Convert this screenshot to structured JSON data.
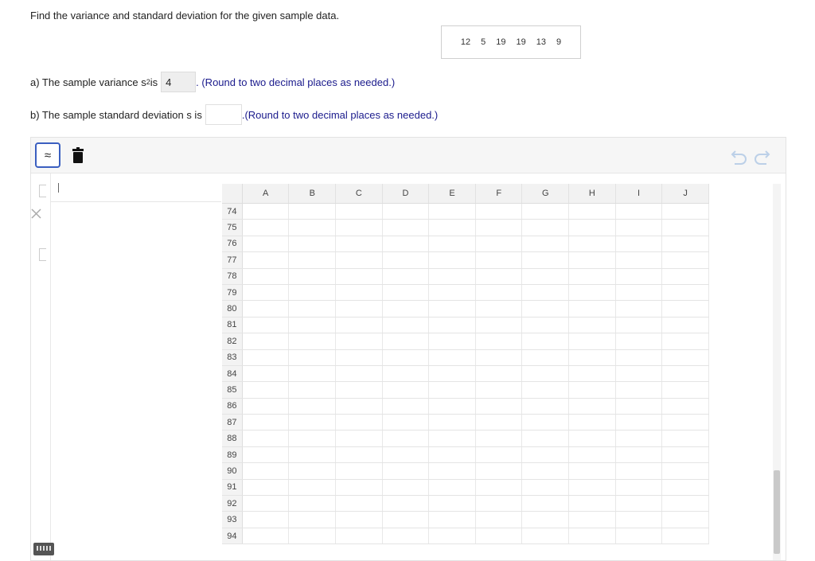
{
  "question": {
    "prompt": "Find the variance and standard deviation for the given sample data.",
    "sample_data": [
      "12",
      "5",
      "19",
      "19",
      "13",
      "9"
    ],
    "part_a": {
      "prefix": "a) The sample variance s",
      "exponent": "2",
      "suffix": " is",
      "value": "4",
      "hint": ". (Round to two decimal places as needed.)"
    },
    "part_b": {
      "prefix": "b) The sample standard deviation s is",
      "value": "",
      "hint": ".(Round to two decimal places as needed.)"
    }
  },
  "calculator": {
    "approx_symbol": "≈",
    "columns": [
      "A",
      "B",
      "C",
      "D",
      "E",
      "F",
      "G",
      "H",
      "I",
      "J"
    ],
    "rows": [
      "74",
      "75",
      "76",
      "77",
      "78",
      "79",
      "80",
      "81",
      "82",
      "83",
      "84",
      "85",
      "86",
      "87",
      "88",
      "89",
      "90",
      "91",
      "92",
      "93",
      "94"
    ]
  }
}
